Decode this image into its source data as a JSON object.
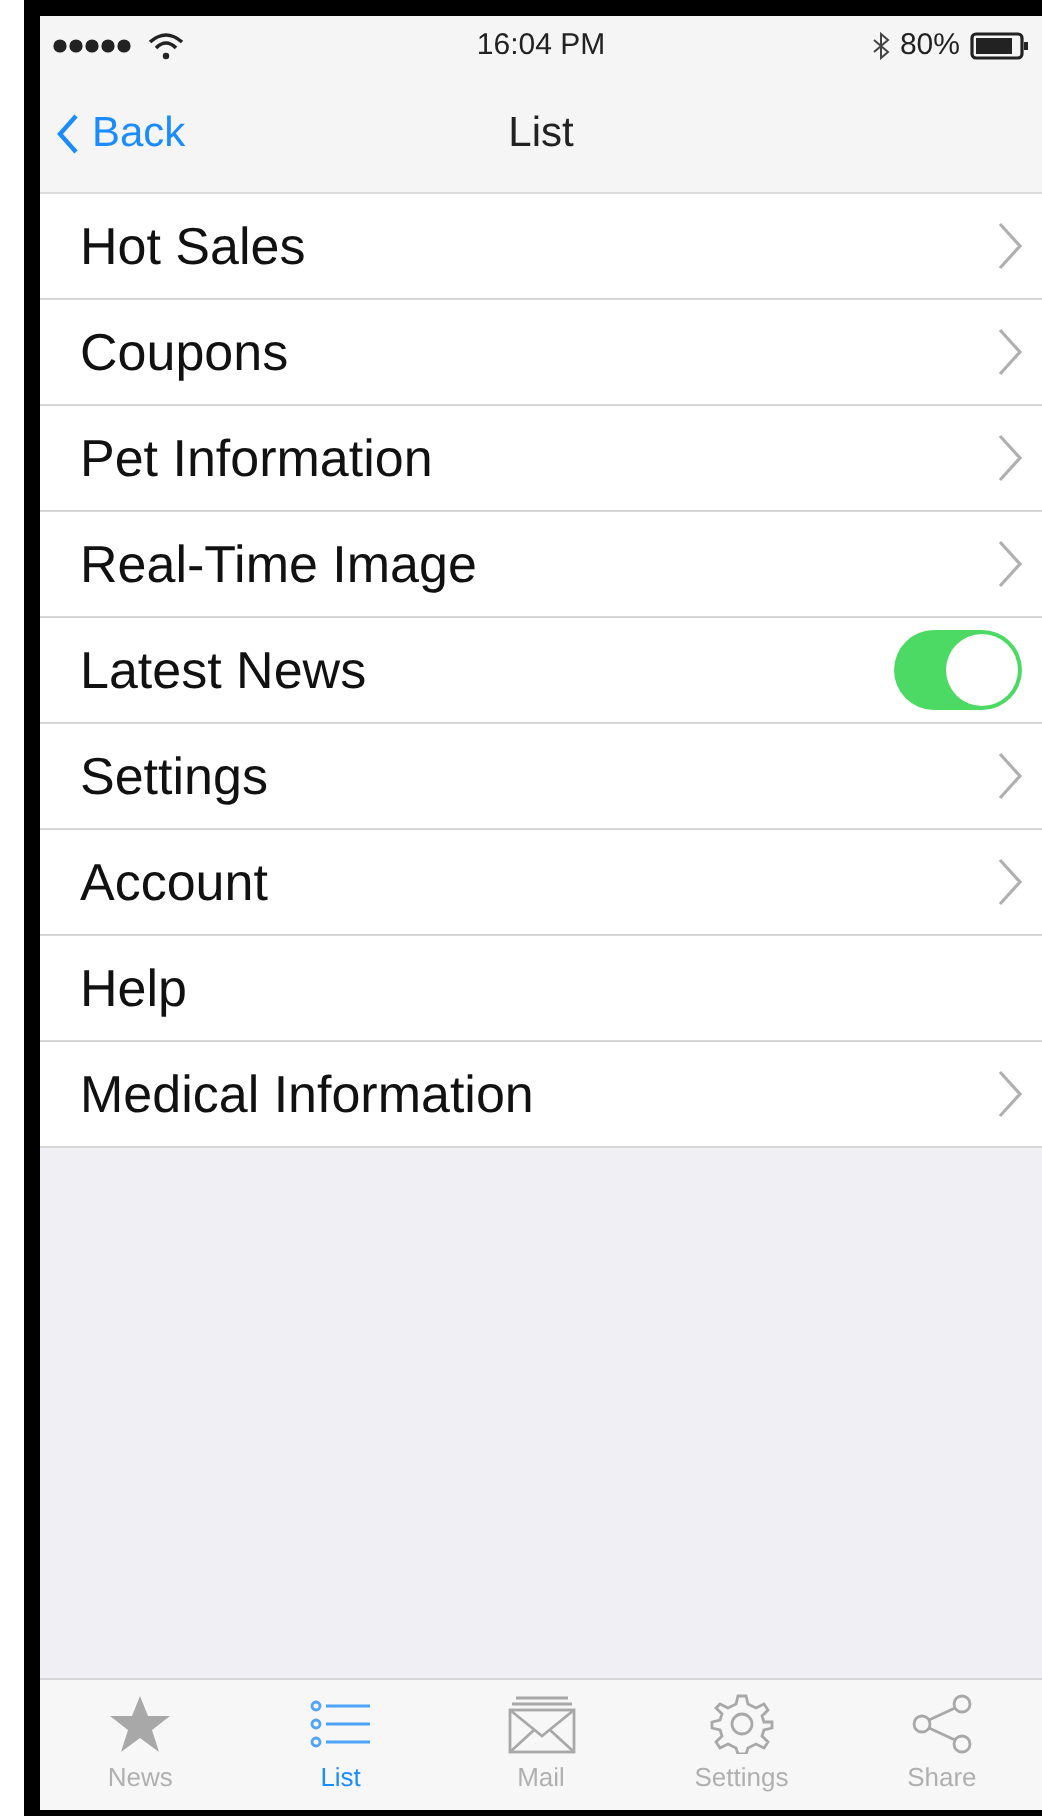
{
  "status_bar": {
    "time": "16:04 PM",
    "battery": "80%"
  },
  "nav_bar": {
    "back": "Back",
    "title": "List"
  },
  "list": [
    {
      "label": "Hot Sales",
      "kind": "chevron"
    },
    {
      "label": "Coupons",
      "kind": "chevron"
    },
    {
      "label": "Pet Information",
      "kind": "chevron"
    },
    {
      "label": "Real-Time Image",
      "kind": "chevron"
    },
    {
      "label": "Latest News",
      "kind": "toggle",
      "on": true
    },
    {
      "label": "Settings",
      "kind": "chevron"
    },
    {
      "label": "Account",
      "kind": "chevron"
    },
    {
      "label": "Help",
      "kind": "plain"
    },
    {
      "label": "Medical Information",
      "kind": "chevron"
    }
  ],
  "tab_bar": [
    {
      "label": "News",
      "kind": "star",
      "selected": false
    },
    {
      "label": "List",
      "kind": "list",
      "selected": true
    },
    {
      "label": "Mail",
      "kind": "mail",
      "selected": false
    },
    {
      "label": "Settings",
      "kind": "gear",
      "selected": false
    },
    {
      "label": "Share",
      "kind": "share",
      "selected": false
    }
  ]
}
